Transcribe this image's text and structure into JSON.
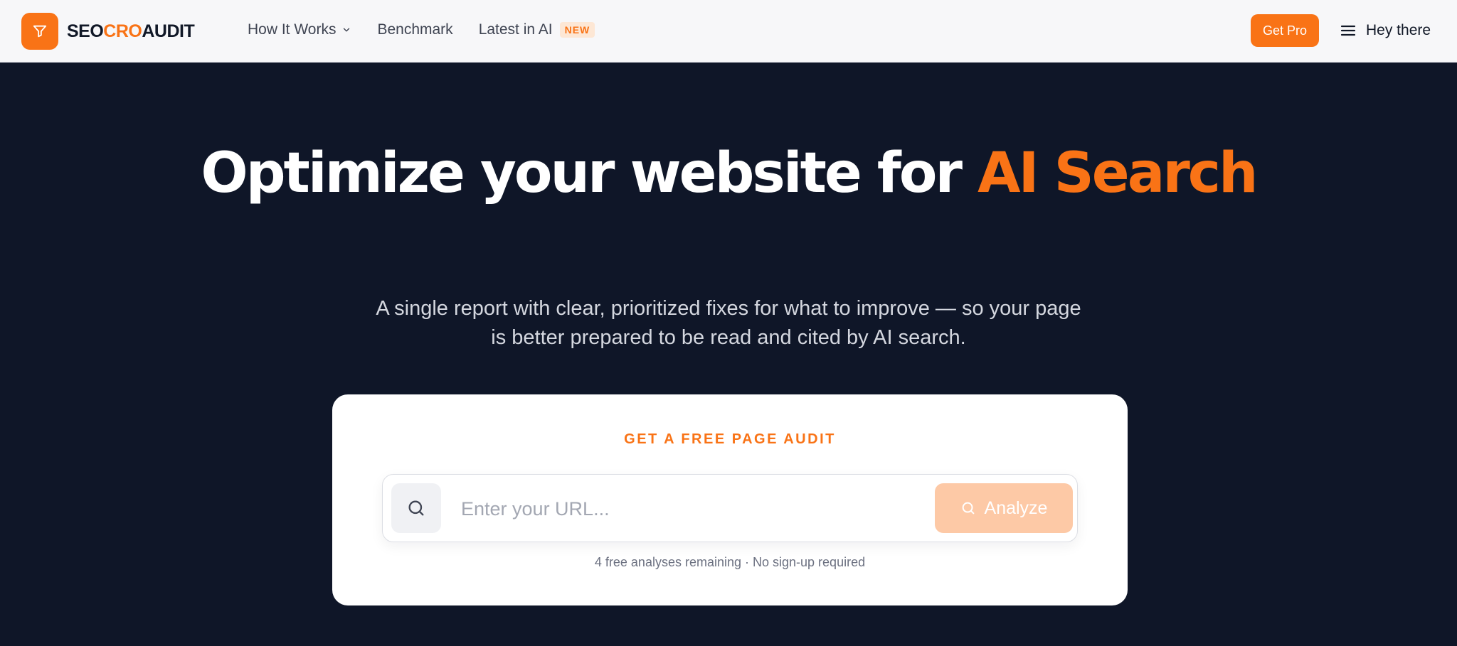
{
  "brand": {
    "name_part1": "SEO",
    "name_part2": "CRO",
    "name_part3": "AUDIT",
    "logo_icon": "funnel-icon",
    "accent_color": "#f97316"
  },
  "nav": {
    "items": [
      {
        "label": "How It Works",
        "has_dropdown": true
      },
      {
        "label": "Benchmark"
      },
      {
        "label": "Latest in AI",
        "badge": "NEW"
      }
    ]
  },
  "header": {
    "cta_label": "Get Pro",
    "menu_icon": "hamburger-icon",
    "menu_label": "Hey there"
  },
  "hero": {
    "title_main": "Optimize your website for ",
    "title_accent": "AI Search",
    "subtitle": "A single report with clear, prioritized fixes for what to improve — so your page is better prepared to be read and cited by AI search."
  },
  "audit_card": {
    "kicker": "GET A FREE PAGE AUDIT",
    "input_placeholder": "Enter your URL...",
    "input_value": "",
    "analyze_label": "Analyze",
    "note": "4 free analyses remaining · No sign-up required"
  },
  "colors": {
    "background": "#0f1628",
    "header_bg": "#f7f7f9",
    "accent": "#f97316",
    "analyze_disabled": "#fdc9a6"
  }
}
